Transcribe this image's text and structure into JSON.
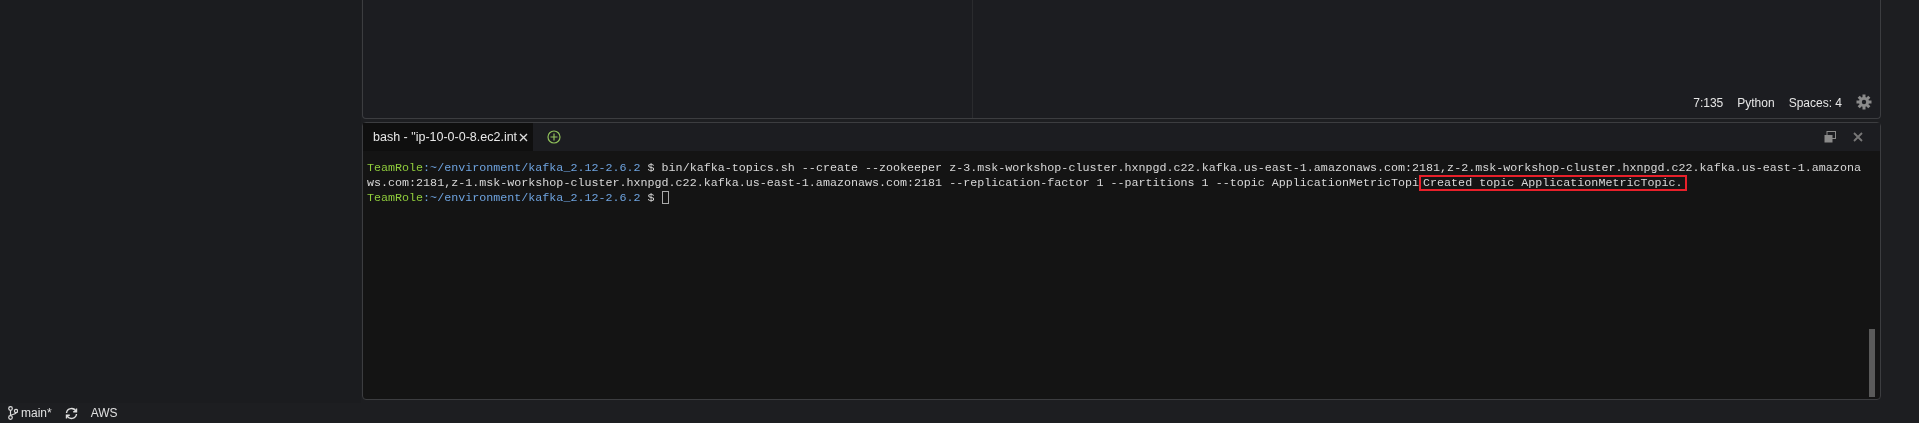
{
  "editor": {
    "status": [
      {
        "text": "7:135"
      },
      {
        "text": "Python"
      },
      {
        "text": "Spaces: 4"
      }
    ]
  },
  "terminal": {
    "tabs": [
      {
        "label": "bash - \"ip-10-0-0-8.ec2.int",
        "selected": true
      }
    ],
    "lines": [
      {
        "segments": [
          {
            "kind": "user",
            "text": "TeamRole"
          },
          {
            "kind": "path",
            "text": ":~/environment/kafka_2.12-2.6.2"
          },
          {
            "kind": "plain",
            "text": " $ bin/kafka-topics.sh --create --zookeeper z-3.msk-workshop-cluster.hxnpgd.c22.kafka.us-east-1.amazonaws.com:2181,z-2.msk-workshop-cluster.hxnpgd.c22.kafka.us-east-1.amazona"
          }
        ],
        "cursor": false
      },
      {
        "segments": [
          {
            "kind": "plain",
            "text": "ws.com:2181,z-1.msk-workshop-cluster.hxnpgd.c22.kafka.us-east-1.amazonaws.com:2181 --replication-factor 1 --partitions 1 --topic ApplicationMetricTopi"
          },
          {
            "kind": "output",
            "text": "Created topic ApplicationMetricTopic.",
            "highlighted": true
          }
        ],
        "cursor": false
      },
      {
        "segments": [
          {
            "kind": "user",
            "text": "TeamRole"
          },
          {
            "kind": "path",
            "text": ":~/environment/kafka_2.12-2.6.2"
          },
          {
            "kind": "plain",
            "text": " $ "
          }
        ],
        "cursor": true
      }
    ]
  },
  "status_bar": {
    "branch": "main*",
    "aws": "AWS"
  }
}
